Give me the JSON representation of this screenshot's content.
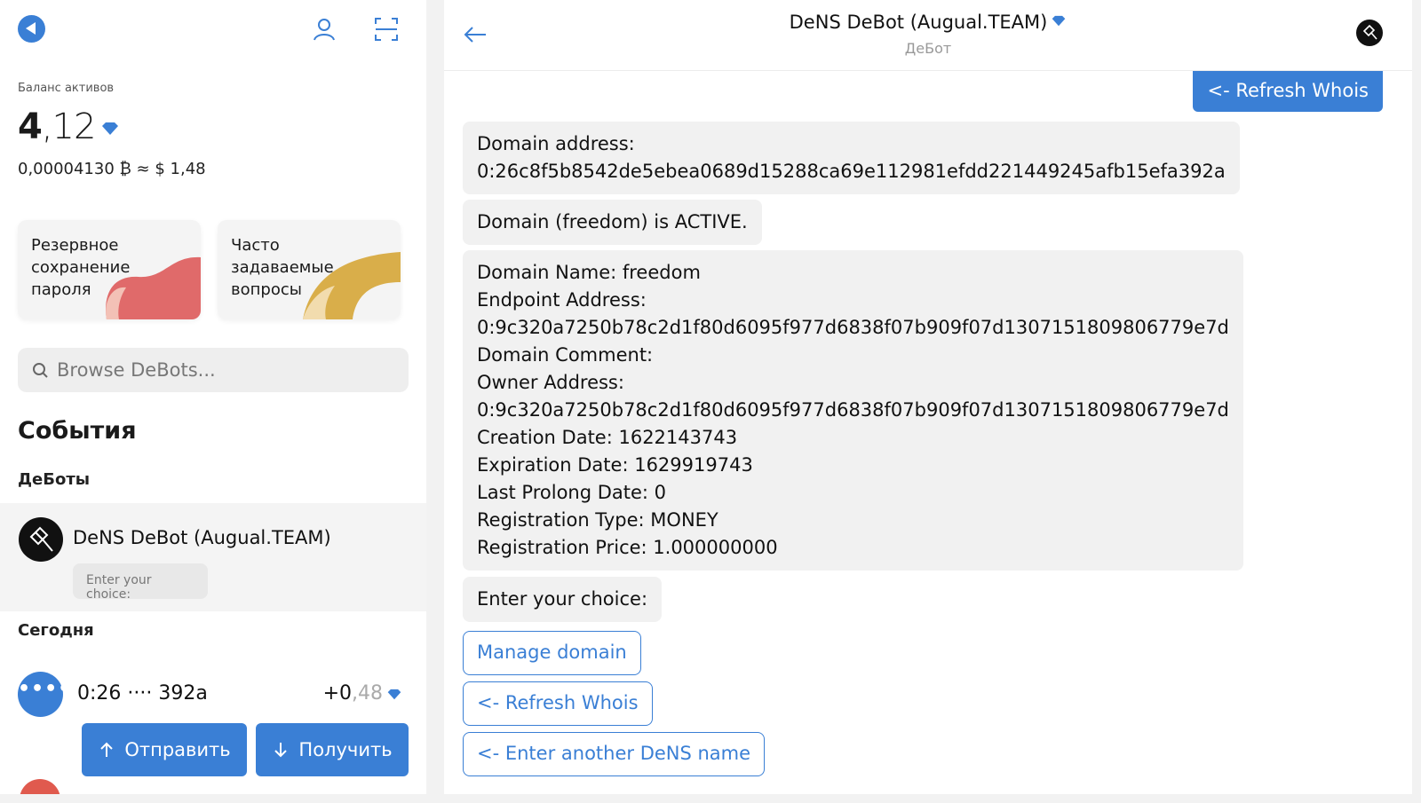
{
  "wallet": {
    "balance_label": "Баланс активов",
    "balance_int": "4",
    "balance_frac": ",12",
    "balance_fiat": "0,00004130 ₿ ≈ $ 1,48",
    "accent_color": "#3a7fd5"
  },
  "top_icons": [
    "profile-icon",
    "scan-icon"
  ],
  "cards": [
    {
      "label_lines": [
        "Резервное",
        "сохранение",
        "пароля"
      ],
      "color": "#e06a6a"
    },
    {
      "label_lines": [
        "Часто",
        "задаваемые",
        "вопросы"
      ],
      "color": "#d9ae4a"
    }
  ],
  "search": {
    "placeholder": "Browse DeBots..."
  },
  "events": {
    "title": "События",
    "debots_title": "ДеБоты",
    "debot": {
      "name": "DeNS DeBot (Augual.TEAM)",
      "last_message": "Enter your choice:"
    },
    "today_title": "Сегодня",
    "tx": {
      "icon": "••••",
      "address": "0:26 ···· 392a",
      "amount_main": "+0",
      "amount_dim": ",48"
    }
  },
  "actions": {
    "send": "Отправить",
    "receive": "Получить"
  },
  "chat": {
    "title": "DeNS DeBot (Augual.TEAM)",
    "subtitle": "ДеБот",
    "user_message": "<- Refresh Whois",
    "messages": [
      {
        "lines": [
          "Domain address:",
          "0:26c8f5b8542de5ebea0689d15288ca69e112981efdd221449245afb15efa392a"
        ]
      },
      {
        "lines": [
          "Domain (freedom) is ACTIVE."
        ]
      },
      {
        "lines": [
          "Domain Name: freedom",
          "Endpoint Address:",
          "0:9c320a7250b78c2d1f80d6095f977d6838f07b909f07d1307151809806779e7d",
          "Domain Comment:",
          "Owner Address:",
          "0:9c320a7250b78c2d1f80d6095f977d6838f07b909f07d1307151809806779e7d",
          "Creation Date: 1622143743",
          "Expiration Date: 1629919743",
          "Last Prolong Date: 0",
          "Registration Type: MONEY",
          "Registration Price: 1.000000000"
        ]
      },
      {
        "lines": [
          "Enter your choice:"
        ]
      }
    ],
    "options": [
      "Manage domain",
      "<- Refresh Whois",
      "<- Enter another DeNS name"
    ]
  }
}
